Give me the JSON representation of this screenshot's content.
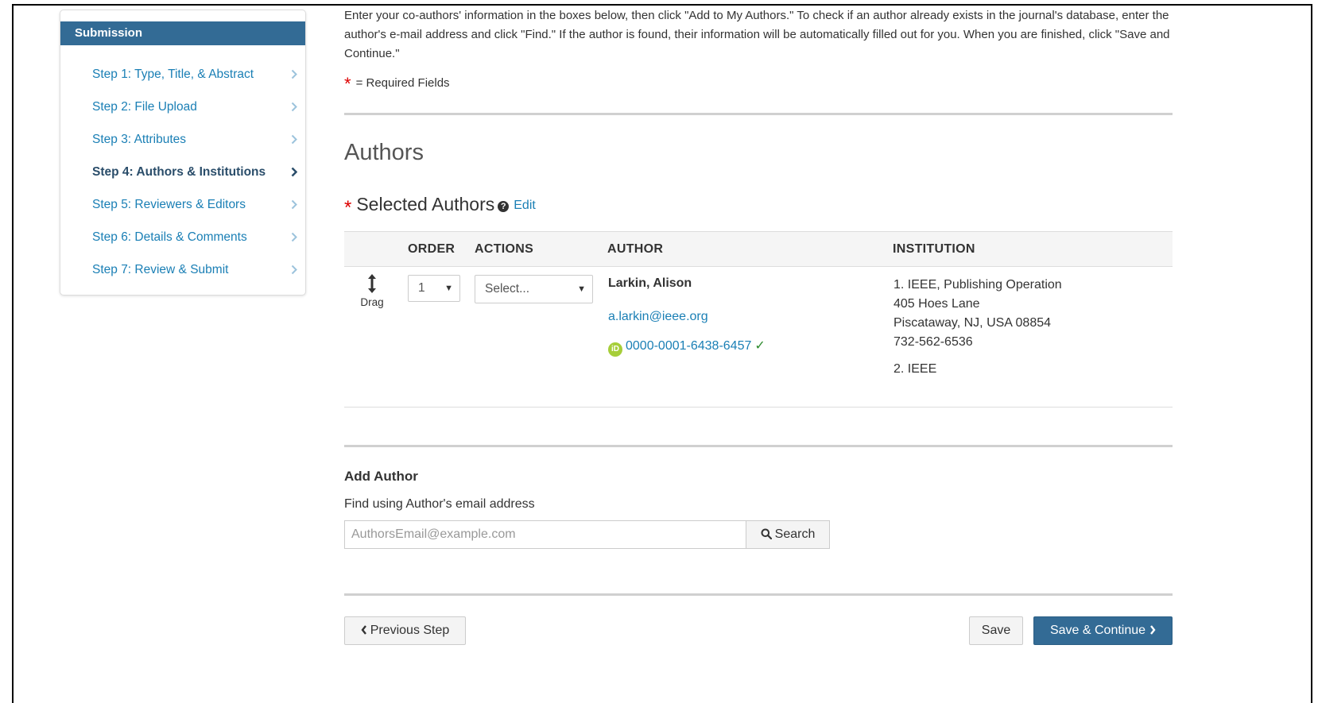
{
  "sidebar": {
    "header": "Submission",
    "steps": [
      {
        "label": "Step 1: Type, Title, & Abstract"
      },
      {
        "label": "Step 2: File Upload"
      },
      {
        "label": "Step 3: Attributes"
      },
      {
        "label": "Step 4: Authors & Institutions"
      },
      {
        "label": "Step 5: Reviewers & Editors"
      },
      {
        "label": "Step 6: Details & Comments"
      },
      {
        "label": "Step 7: Review & Submit"
      }
    ],
    "active_step": 4
  },
  "intro_text": "Enter your co-authors' information in the boxes below, then click \"Add to My Authors.\" To check if an author already exists in the journal's database, enter the author's e-mail address and click \"Find.\" If the author is found, their information will be automatically filled out for you. When you are finished, click \"Save and Continue.\"",
  "required_star": "*",
  "required_note": "= Required Fields",
  "section_title": "Authors",
  "selected_authors": {
    "title": "Selected Authors",
    "help_icon": "?",
    "edit_label": "Edit"
  },
  "table": {
    "headers": {
      "order": "ORDER",
      "actions": "ACTIONS",
      "author": "AUTHOR",
      "institution": "INSTITUTION"
    },
    "row": {
      "drag_label": "Drag",
      "order_value": "1",
      "actions_value": "Select...",
      "author_name": "Larkin, Alison",
      "author_email": "a.larkin@ieee.org",
      "orcid_badge": "iD",
      "orcid": "0000-0001-6438-6457",
      "verified_mark": "✓",
      "institutions": [
        "1. IEEE, Publishing Operation",
        "405 Hoes Lane",
        "Piscataway, NJ, USA 08854",
        "732-562-6536",
        "2. IEEE"
      ]
    }
  },
  "add_author": {
    "title": "Add Author",
    "find_label": "Find using Author's email address",
    "email_placeholder": "AuthorsEmail@example.com",
    "email_value": "",
    "search_label": "Search"
  },
  "footer": {
    "previous_label": "Previous Step",
    "save_label": "Save",
    "save_continue_label": "Save & Continue"
  },
  "colors": {
    "brand": "#336b95",
    "link": "#1a7fb5",
    "required": "#dd0000",
    "orcid": "#a6ce39"
  },
  "icons": {
    "chevron": "chevron-right-icon",
    "drag": "vertical-arrows-icon",
    "search": "search-icon",
    "help": "question-circle-icon",
    "orcid": "orcid-icon",
    "check": "check-icon"
  }
}
